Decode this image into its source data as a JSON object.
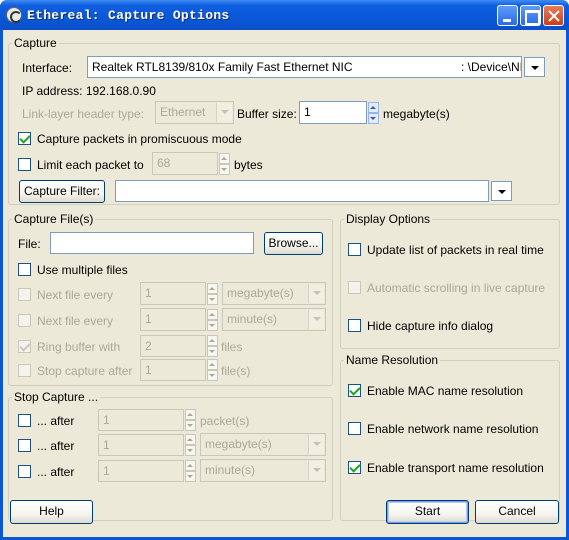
{
  "window": {
    "title": "Ethereal: Capture Options"
  },
  "capture": {
    "legend": "Capture",
    "interface_label": "Interface:",
    "interface_value": "Realtek RTL8139/810x Family Fast Ethernet NIC",
    "interface_device": ": \\Device\\NI",
    "ip_address": "IP address: 192.168.0.90",
    "link_layer_label": "Link-layer header type:",
    "link_layer_value": "Ethernet",
    "buffer_label": "Buffer size:",
    "buffer_value": "1",
    "buffer_unit": "megabyte(s)",
    "promiscuous_label": "Capture packets in promiscuous mode",
    "promiscuous_checked": true,
    "limit_label": "Limit each packet to",
    "limit_value": "68",
    "limit_unit": "bytes",
    "filter_button": "Capture Filter:",
    "filter_value": ""
  },
  "capture_files": {
    "legend": "Capture File(s)",
    "file_label": "File:",
    "file_value": "",
    "browse_button": "Browse...",
    "multiple_files_label": "Use multiple files",
    "next_file_size_label": "Next file every",
    "next_file_size_value": "1",
    "next_file_size_unit": "megabyte(s)",
    "next_file_time_label": "Next file every",
    "next_file_time_value": "1",
    "next_file_time_unit": "minute(s)",
    "ring_buffer_label": "Ring buffer with",
    "ring_buffer_value": "2",
    "ring_buffer_unit": "files",
    "stop_after_label": "Stop capture after",
    "stop_after_value": "1",
    "stop_after_unit": "file(s)"
  },
  "stop_capture": {
    "legend": "Stop Capture ...",
    "after_label": "... after",
    "packets_value": "1",
    "packets_unit": "packet(s)",
    "size_value": "1",
    "size_unit": "megabyte(s)",
    "time_value": "1",
    "time_unit": "minute(s)"
  },
  "display_options": {
    "legend": "Display Options",
    "update_realtime_label": "Update list of packets in real time",
    "auto_scroll_label": "Automatic scrolling in live capture",
    "hide_info_label": "Hide capture info dialog"
  },
  "name_resolution": {
    "legend": "Name Resolution",
    "mac_label": "Enable MAC name resolution",
    "mac_checked": true,
    "network_label": "Enable network name resolution",
    "network_checked": false,
    "transport_label": "Enable transport name resolution",
    "transport_checked": true
  },
  "buttons": {
    "help": "Help",
    "start": "Start",
    "cancel": "Cancel"
  }
}
